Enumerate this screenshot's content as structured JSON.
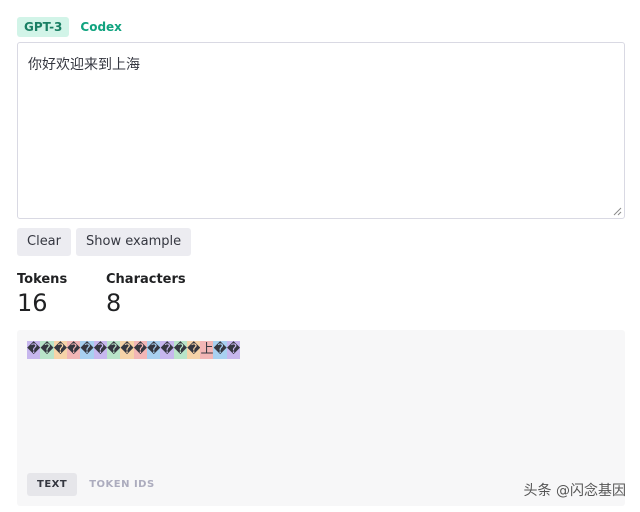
{
  "model_tabs": [
    {
      "label": "GPT-3",
      "active": true
    },
    {
      "label": "Codex",
      "active": false
    }
  ],
  "input": {
    "value": "你好欢迎来到上海"
  },
  "buttons": {
    "clear": "Clear",
    "show_example": "Show example"
  },
  "stats": {
    "tokens_label": "Tokens",
    "tokens_value": "16",
    "characters_label": "Characters",
    "characters_value": "8"
  },
  "output": {
    "tokens": [
      {
        "text": "�",
        "color": "#c7b7ee"
      },
      {
        "text": "�",
        "color": "#b9e4c9"
      },
      {
        "text": "�",
        "color": "#f6d3a8"
      },
      {
        "text": "�",
        "color": "#f2b6b6"
      },
      {
        "text": "�",
        "color": "#a8d0f0"
      },
      {
        "text": "�",
        "color": "#c7b7ee"
      },
      {
        "text": "�",
        "color": "#b9e4c9"
      },
      {
        "text": "�",
        "color": "#f6d3a8"
      },
      {
        "text": "�",
        "color": "#f2b6b6"
      },
      {
        "text": "�",
        "color": "#a8d0f0"
      },
      {
        "text": "�",
        "color": "#c7b7ee"
      },
      {
        "text": "�",
        "color": "#b9e4c9"
      },
      {
        "text": "�",
        "color": "#f6d3a8"
      },
      {
        "text": "上",
        "color": "#f2b6b6"
      },
      {
        "text": "�",
        "color": "#a8d0f0"
      },
      {
        "text": "�",
        "color": "#c7b7ee"
      }
    ]
  },
  "view_tabs": [
    {
      "label": "TEXT",
      "active": true
    },
    {
      "label": "TOKEN IDS",
      "active": false
    }
  ],
  "watermark": "头条 @闪念基因"
}
